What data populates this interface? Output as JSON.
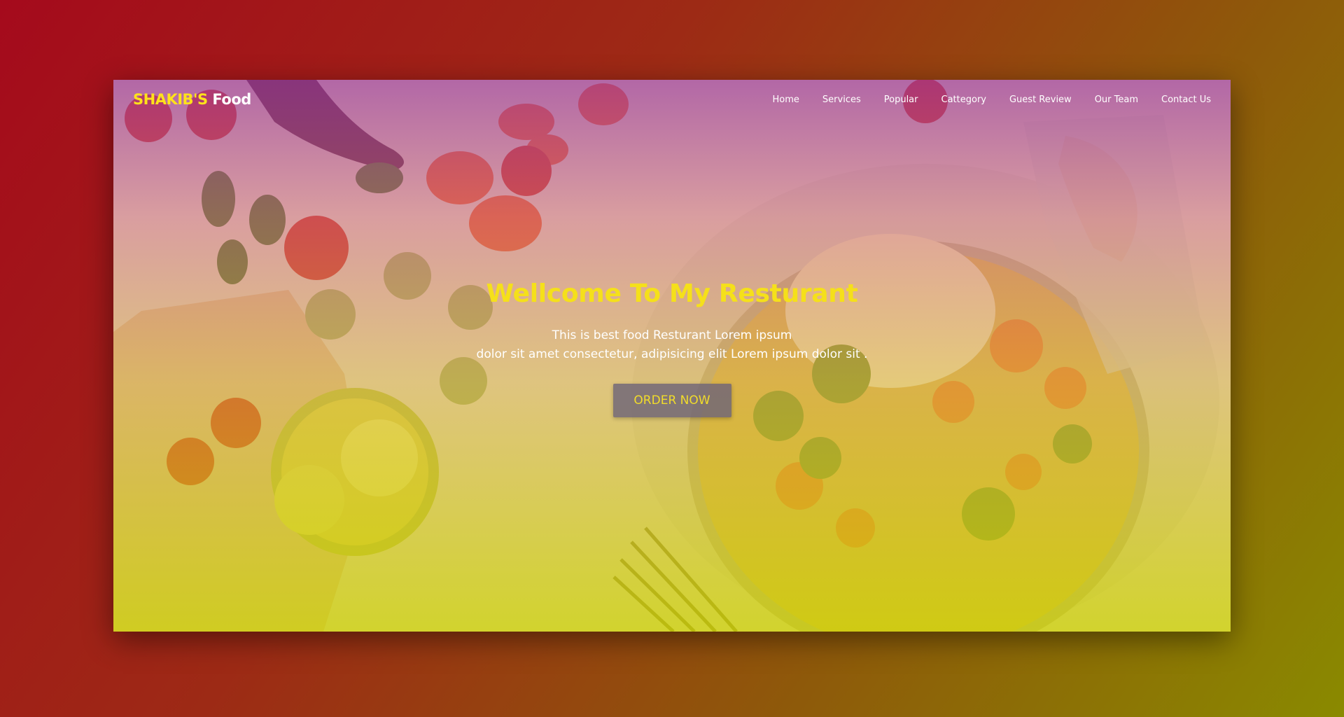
{
  "brand": {
    "part1": "SHAKIB'S",
    "part2": "Food",
    "color1": "#ffe21a",
    "color2": "#ffffff"
  },
  "nav": {
    "items": [
      {
        "label": "Home"
      },
      {
        "label": "Services"
      },
      {
        "label": "Popular"
      },
      {
        "label": "Cattegory"
      },
      {
        "label": "Guest Review"
      },
      {
        "label": "Our Team"
      },
      {
        "label": "Contact Us"
      }
    ]
  },
  "hero": {
    "title": "Wellcome To My Resturant",
    "line1": "This is best food Resturant Lorem ipsum",
    "line2": "dolor sit amet consectetur, adipisicing elit Lorem ipsum dolor sit .",
    "cta": "ORDER NOW"
  },
  "theme": {
    "accent": "#f5e01a",
    "button_bg": "#6e6478"
  }
}
